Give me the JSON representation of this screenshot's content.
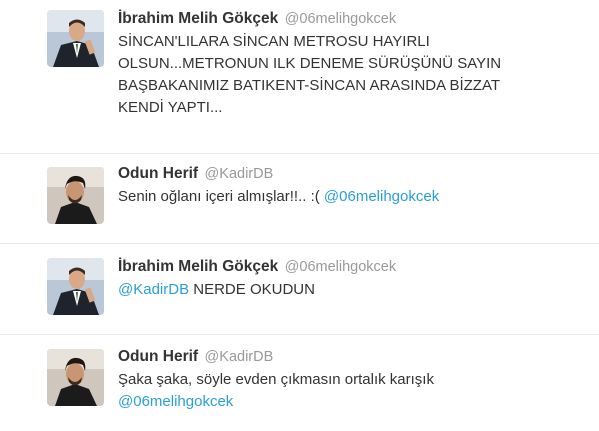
{
  "tweets": [
    {
      "name": "İbrahim Melih Gökçek",
      "handle": "@06melihgokcek",
      "text_lines": [
        "SİNCAN'LILARA SİNCAN METROSU HAYIRLI",
        "OLSUN...METRONUN ILK DENEME SÜRÜŞÜNÜ SAYIN",
        "BAŞBAKANIMIZ BATIKENT-SİNCAN ARASINDA BİZZAT",
        "KENDİ YAPTI..."
      ]
    },
    {
      "name": "Odun Herif",
      "handle": "@KadirDB",
      "text_before": "Senin oğlanı içeri almışlar!!.. :(",
      "mention": "@06melihgokcek"
    },
    {
      "name": "İbrahim Melih Gökçek",
      "handle": "@06melihgokcek",
      "mention": "@KadirDB",
      "text_after": "NERDE OKUDUN"
    },
    {
      "name": "Odun Herif",
      "handle": "@KadirDB",
      "text_before": "Şaka şaka, söyle evden çıkmasın ortalık karışık",
      "mention": "@06melihgokcek"
    }
  ],
  "colors": {
    "name": "#333333",
    "handle": "#999999",
    "mention": "#2a9fd6",
    "divider": "#e8e8e8"
  },
  "avatars": [
    "politician-avatar",
    "young-man-avatar",
    "politician-avatar",
    "young-man-avatar"
  ]
}
